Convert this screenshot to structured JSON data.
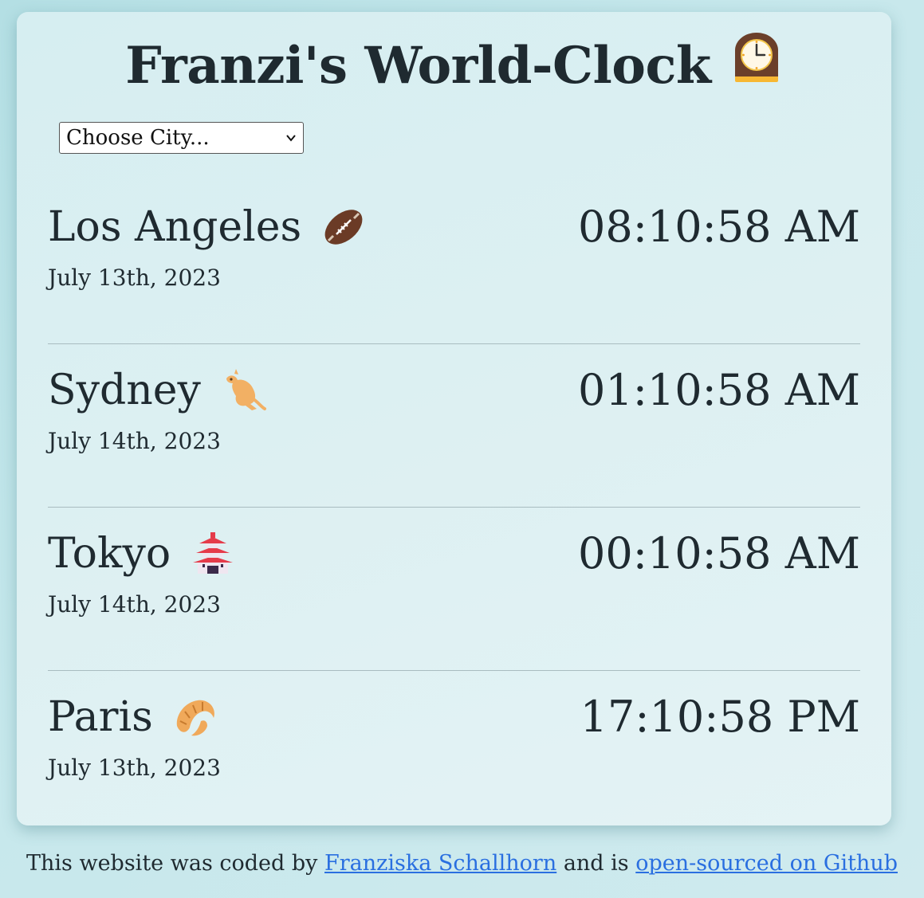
{
  "header": {
    "title": "Franzi's World-Clock",
    "title_icon": "mantelpiece-clock-icon"
  },
  "controls": {
    "city_select": {
      "selected": "Choose City..."
    }
  },
  "cities": [
    {
      "name": "Los Angeles",
      "icon": "american-football-icon",
      "date": "July 13th, 2023",
      "time": "08:10:58 AM"
    },
    {
      "name": "Sydney",
      "icon": "kangaroo-icon",
      "date": "July 14th, 2023",
      "time": "01:10:58 AM"
    },
    {
      "name": "Tokyo",
      "icon": "japanese-castle-icon",
      "date": "July 14th, 2023",
      "time": "00:10:58 AM"
    },
    {
      "name": "Paris",
      "icon": "croissant-icon",
      "date": "July 13th, 2023",
      "time": "17:10:58 PM"
    }
  ],
  "footer": {
    "prefix": "This website was coded by",
    "author_link": "Franziska Schallhorn",
    "middle": "and is",
    "repo_link": "open-sourced on Github"
  },
  "colors": {
    "text": "#1f2a30",
    "link": "#2a6fe0",
    "card_bg": "#dcf0f2",
    "page_bg": "#c3e5ea"
  }
}
